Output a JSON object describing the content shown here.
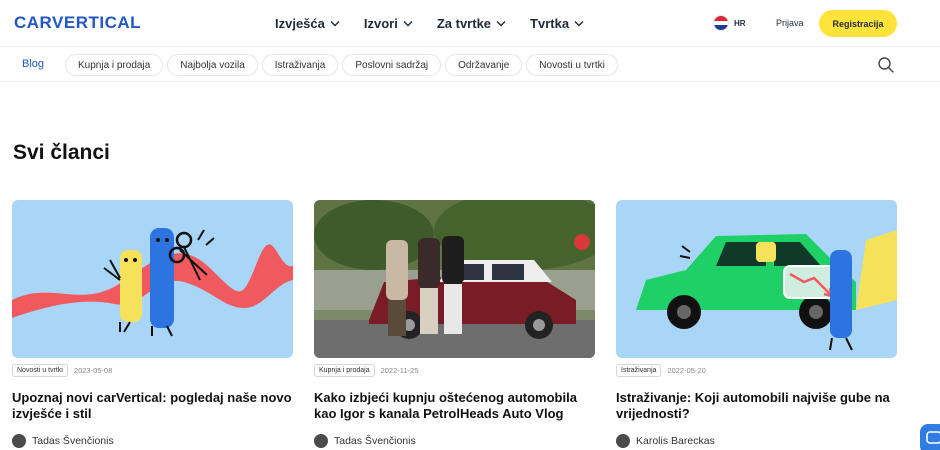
{
  "header": {
    "logo": "CARVERTICAL",
    "nav": [
      {
        "label": "Izvješća"
      },
      {
        "label": "Izvori"
      },
      {
        "label": "Za tvrtke"
      },
      {
        "label": "Tvrtka"
      }
    ],
    "language": "HR",
    "login_label": "Prijava",
    "register_label": "Registracija",
    "accent_color": "#ffe33b",
    "brand_color": "#2157c6"
  },
  "subnav": {
    "blog_label": "Blog",
    "categories": [
      "Kupnja i prodaja",
      "Najbolja vozila",
      "Istraživanja",
      "Poslovni sadržaj",
      "Održavanje",
      "Novosti u tvrtki"
    ]
  },
  "main": {
    "heading": "Svi članci",
    "articles": [
      {
        "tag": "Novosti u tvrtki",
        "date": "2023-05-08",
        "title": "Upoznaj novi carVertical: pogledaj naše novo izvješće i stil",
        "author": "Tadas Švenčionis"
      },
      {
        "tag": "Kupnja i prodaja",
        "date": "2022-11-25",
        "title": "Kako izbjeći kupnju oštećenog automobila kao Igor s kanala PetrolHeads Auto Vlog",
        "author": "Tadas Švenčionis"
      },
      {
        "tag": "Istraživanja",
        "date": "2022-05-20",
        "title": "Istraživanje: Koji automobili najviše gube na vrijednosti?",
        "author": "Karolis Bareckas"
      }
    ]
  }
}
